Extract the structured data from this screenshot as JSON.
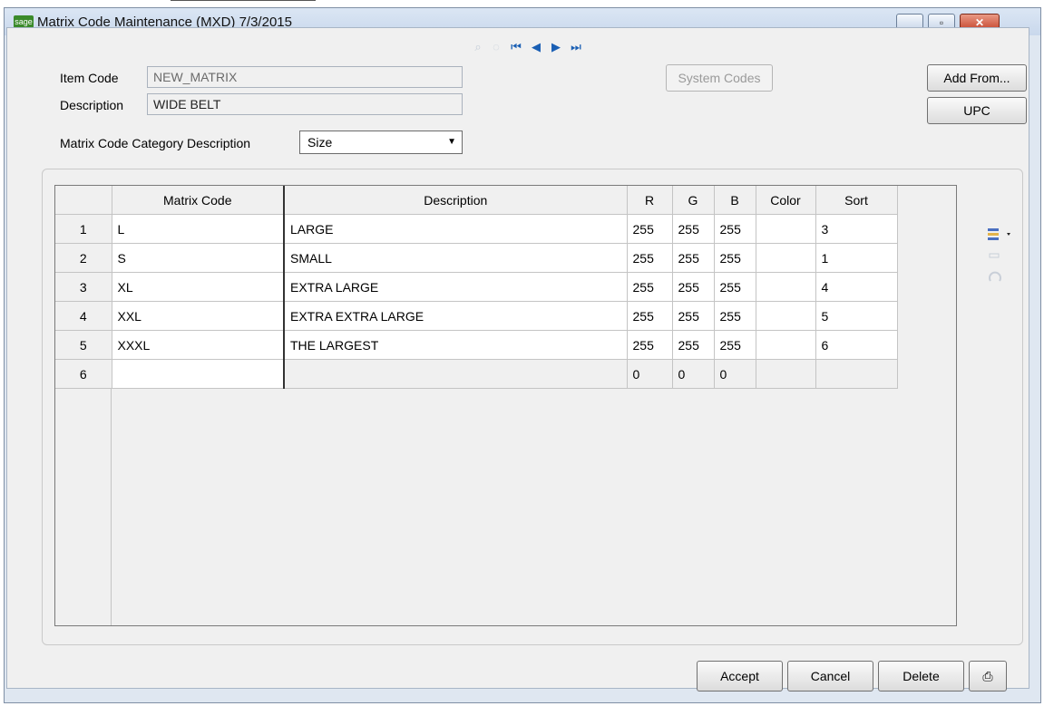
{
  "window": {
    "title": "Matrix Code Maintenance (MXD) 7/3/2015",
    "app_icon": "sage",
    "controls": [
      "minimize-icon",
      "maximize-icon",
      "close-icon"
    ]
  },
  "header": {
    "item_code_label": "Item Code",
    "item_code_value": "NEW_MATRIX",
    "description_label": "Description",
    "description_value": "WIDE BELT",
    "category_label": "Matrix Code Category Description",
    "category_value": "Size",
    "system_codes_label": "System Codes",
    "add_from_label": "Add From...",
    "upc_label": "UPC"
  },
  "grid": {
    "columns": [
      "",
      "Matrix Code",
      "Description",
      "R",
      "G",
      "B",
      "Color",
      "Sort"
    ],
    "rows": [
      {
        "num": "1",
        "code": "L",
        "desc": "LARGE",
        "r": "255",
        "g": "255",
        "b": "255",
        "color": "",
        "sort": "3"
      },
      {
        "num": "2",
        "code": "S",
        "desc": "SMALL",
        "r": "255",
        "g": "255",
        "b": "255",
        "color": "",
        "sort": "1"
      },
      {
        "num": "3",
        "code": "XL",
        "desc": "EXTRA LARGE",
        "r": "255",
        "g": "255",
        "b": "255",
        "color": "",
        "sort": "4"
      },
      {
        "num": "4",
        "code": "XXL",
        "desc": "EXTRA EXTRA LARGE",
        "r": "255",
        "g": "255",
        "b": "255",
        "color": "",
        "sort": "5"
      },
      {
        "num": "5",
        "code": "XXXL",
        "desc": "THE LARGEST",
        "r": "255",
        "g": "255",
        "b": "255",
        "color": "",
        "sort": "6"
      },
      {
        "num": "6",
        "code": "",
        "desc": "",
        "r": "0",
        "g": "0",
        "b": "0",
        "color": "",
        "sort": ""
      }
    ]
  },
  "footer": {
    "accept_label": "Accept",
    "cancel_label": "Cancel",
    "delete_label": "Delete"
  },
  "colors": {
    "title_bg": "#c9d8ec",
    "close_red": "#c4422a",
    "nav_blue": "#1a5fb4",
    "sage_green": "#3a8a2a"
  }
}
